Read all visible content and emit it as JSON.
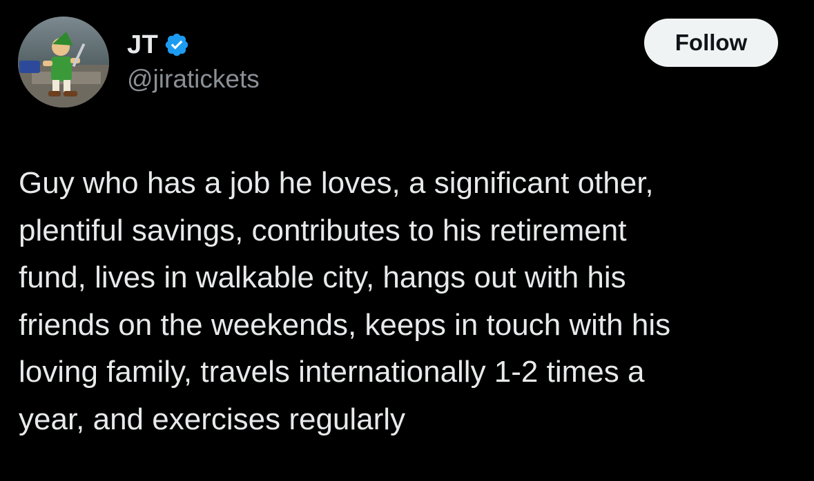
{
  "author": {
    "display_name": "JT",
    "handle": "@jiratickets",
    "verified_icon": "verified-badge-icon",
    "avatar_icon": "avatar-image"
  },
  "follow_button": {
    "label": "Follow"
  },
  "tweet": {
    "text": "Guy who has a job he loves, a significant other,\nplentiful savings, contributes to his retirement\nfund, lives in walkable city, hangs out with his\nfriends on the weekends, keeps in touch with his\nloving family, travels internationally 1-2 times a\nyear, and exercises regularly"
  },
  "colors": {
    "background": "#000000",
    "text_primary": "#e7e9ea",
    "text_secondary": "#8b9096",
    "verified_blue": "#1d9bf0",
    "follow_bg": "#eff3f4",
    "follow_text": "#0f1419"
  }
}
